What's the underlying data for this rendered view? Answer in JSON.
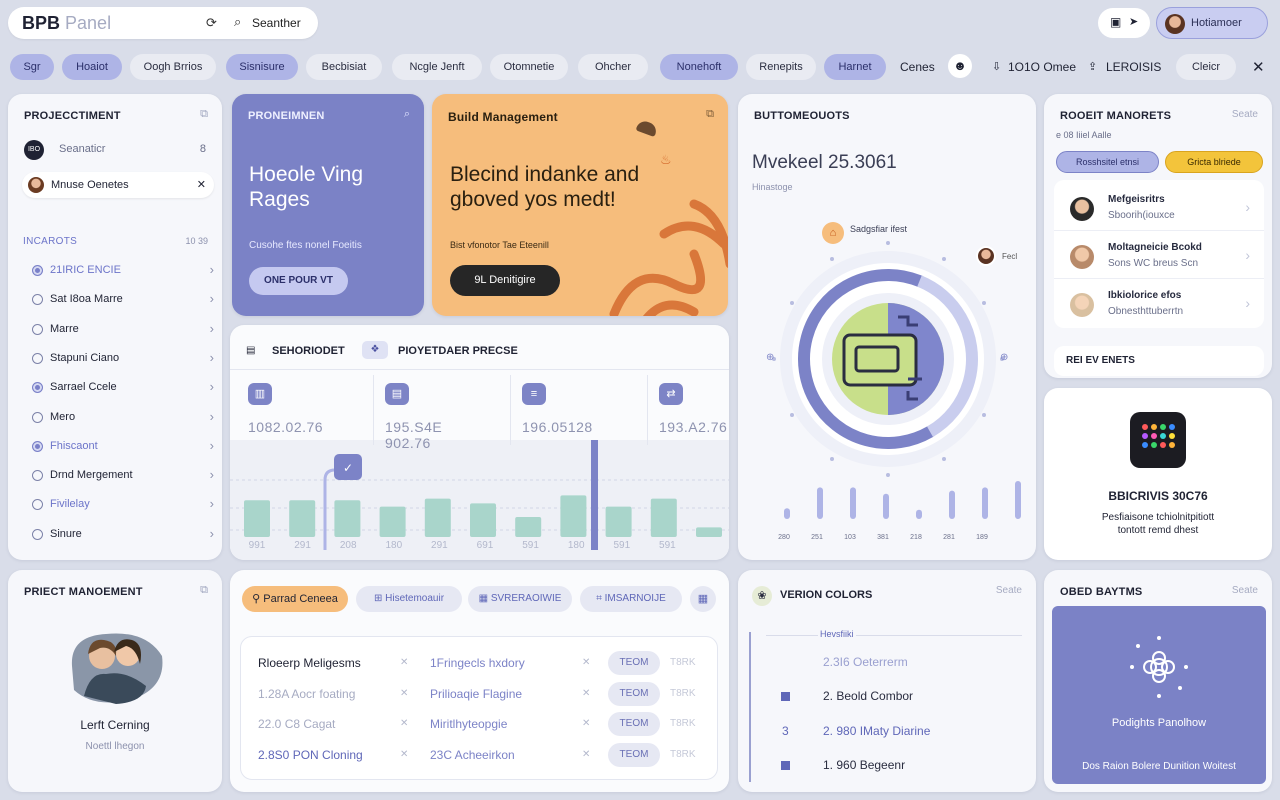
{
  "app": {
    "brand_bold": "BPB",
    "brand_light": "Panel",
    "search_label": "Seanther",
    "user_name": "Hotiamoer"
  },
  "tabs": [
    "Sgr",
    "Hoaiot",
    "Oogh Brrios",
    "Sisnisure",
    "Becbisiat",
    "Ncgle Jenft",
    "Otomnetie",
    "Ohcher",
    "Nonehoft",
    "Renepits",
    "Harnet"
  ],
  "toolbar": {
    "extra1": "Cenes",
    "extra2": "1O1O Omee",
    "extra3": "LEROISIS",
    "extra4": "Cleicr"
  },
  "left_panel": {
    "title": "PROJECCTIMENT",
    "row1": {
      "label": "Seanaticr",
      "value": "8"
    },
    "row2": {
      "label": "Mnuse Oenetes"
    },
    "section_label": "INCAROTS",
    "section_value": "10 39",
    "items": [
      {
        "label": "21IRIC ENCIE",
        "blue": true,
        "filled": true
      },
      {
        "label": "Sat I8oa Marre",
        "blue": false,
        "filled": false
      },
      {
        "label": "Marre",
        "blue": false,
        "filled": false
      },
      {
        "label": "Stapuni Ciano",
        "blue": false,
        "filled": false
      },
      {
        "label": "Sarrael Ccele",
        "blue": false,
        "filled": true
      },
      {
        "label": "Mero",
        "blue": false,
        "filled": false
      },
      {
        "label": "Fhiscaont",
        "blue": true,
        "filled": true
      },
      {
        "label": "Drnd Mergement",
        "blue": false,
        "filled": false
      },
      {
        "label": "Fivilelay",
        "blue": true,
        "filled": false
      },
      {
        "label": "Sinure",
        "blue": false,
        "filled": false
      }
    ]
  },
  "promo_blue": {
    "title": "PRONEIMNEN",
    "headline1": "Hoeole Ving",
    "headline2": "Rages",
    "sub": "Cusohe ftes nonel Foeitis",
    "button": "ONE POUR VT"
  },
  "promo_orange": {
    "title": "Build Management",
    "headline1": "Blecind indanke and",
    "headline2": "gboved yos medt!",
    "sub": "Bist vfonotor Tae Eteenill",
    "button": "9L  Denitigire"
  },
  "stats_card": {
    "tab1": "SEHORIODET",
    "tab2": "PIOYETDAER PRECSE",
    "stats": [
      {
        "icon": "chart-icon",
        "value": "1082.02.76"
      },
      {
        "icon": "calendar-icon",
        "value": "195.S4E 902.76"
      },
      {
        "icon": "list-icon",
        "value": "196.05128"
      },
      {
        "icon": "share-icon",
        "value": "193.A2.76"
      }
    ],
    "bars": [
      0.46,
      0.46,
      0.46,
      0.38,
      0.48,
      0.42,
      0.25,
      0.52,
      0.38,
      0.48,
      0.12
    ],
    "x_labels": [
      "991",
      "291",
      "208",
      "180",
      "291",
      "691",
      "591",
      "180",
      "591",
      "591"
    ]
  },
  "radial_card": {
    "title": "BUTTOMEOUOTS",
    "metric": "Mvekeel 25.3061",
    "sub": "Hinastoge",
    "marker1": "Sadgsfiar ifest",
    "marker2": "Fecl",
    "bars": [
      0.15,
      0.8,
      0.8,
      0.6,
      0.1,
      0.7,
      0.8,
      1.0
    ],
    "x_labels": [
      "280",
      "251",
      "103",
      "381",
      "218",
      "281",
      "189"
    ]
  },
  "people_card": {
    "title": "ROOEIT MANORETS",
    "sub": "e 08 Iiiel Aalle",
    "corner": "Seate",
    "btn1": "Rosshsitel etnsi",
    "btn2": "Gricta blriede",
    "people": [
      {
        "name": "Mefgeisritrs",
        "detail": "Sboorih(iouxce"
      },
      {
        "name": "Moltagneicie Bcokd",
        "detail": "Sons WC breus Scn"
      },
      {
        "name": "Ibkiolorice efos",
        "detail": "Obnesthttuberrtn"
      }
    ],
    "footer": "REI EV ENETS"
  },
  "app_card": {
    "title": "BBICRIVIS 30C76",
    "sub1": "Pesfiaisone tchiolnitpitiott",
    "sub2": "tontott remd dhest"
  },
  "project_card": {
    "title": "PRIECT MANOEMENT",
    "name": "Lerft Cerning",
    "sub": "Noettl lhegon"
  },
  "table_card": {
    "filters": [
      "Parrad Ceneea",
      "Hisetemoauir",
      "SVRERAOIWIE",
      "IMSARNOIJE"
    ],
    "rows": [
      {
        "col1": "Rloeerp Meligesms",
        "col2": "1Fringecls hxdory",
        "tag": "TEOM",
        "tail": "T8RK",
        "dim": false
      },
      {
        "col1": "1.28A Aocr foating",
        "col2": "Prilioaqie Flagine",
        "tag": "TEOM",
        "tail": "T8RK",
        "dim": true
      },
      {
        "col1": "22.0 C8 Cagat",
        "col2": "Miritlhyteopgie",
        "tag": "TEOM",
        "tail": "T8RK",
        "dim": true
      },
      {
        "col1": "2.8S0 PON Cloning",
        "col2": "23C Acheeirkon",
        "tag": "TEOM",
        "tail": "T8RK",
        "dim": false
      }
    ]
  },
  "version_card": {
    "title": "VERION COLORS",
    "corner": "Seate",
    "header": "Hevsfiiki",
    "rows": [
      {
        "marker": "",
        "text": "2.3I6 Oeterrerm",
        "color": "#9aa0d0"
      },
      {
        "marker": "square",
        "text": "2. Beold Combor",
        "color": "#2a2d40"
      },
      {
        "marker": "3",
        "text": "2. 980 IMaty Diarine",
        "color": "#5f67b8"
      },
      {
        "marker": "square",
        "text": "1. 960 Begeenr",
        "color": "#2a2d40"
      }
    ]
  },
  "ops_card": {
    "title": "OBED BAYTMS",
    "corner": "Seate",
    "label": "Podights Panolhow",
    "footer": "Dos Raion Bolere Dunition Woitest"
  }
}
